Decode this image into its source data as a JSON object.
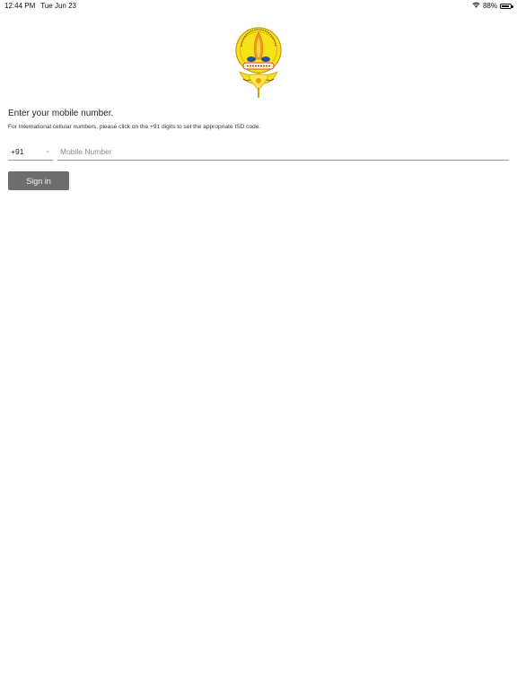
{
  "status_bar": {
    "time": "12:44 PM",
    "date": "Tue Jun 23",
    "battery_percent_label": "88%",
    "battery_level": 0.88,
    "wifi_icon": "wifi-icon",
    "battery_icon": "battery-icon"
  },
  "logo": {
    "icon": "temple-lamp-logo",
    "colors": {
      "yellow": "#f7e21a",
      "orange": "#f39a1f",
      "blue": "#2b4aa8",
      "red": "#c8202c"
    }
  },
  "form": {
    "heading": "Enter your mobile number.",
    "subtext": "For International cellular numbers, please click on the +91 digits to set the appropriate ISD code.",
    "country_code": "+91",
    "chevron_icon": "chevron-down-icon",
    "mobile_placeholder": "Mobile Number",
    "mobile_value": "",
    "signin_label": "Sign in"
  },
  "colors": {
    "button_bg": "#6e6e6e",
    "underline": "#9a9a9a"
  }
}
